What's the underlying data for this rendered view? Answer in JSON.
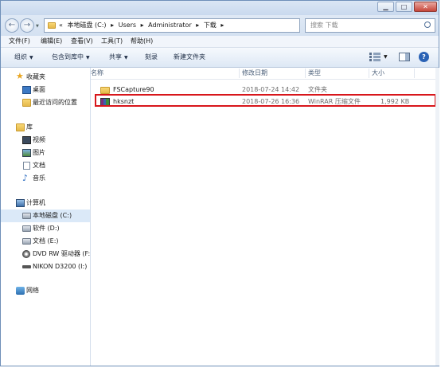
{
  "address": {
    "prefix": "«",
    "crumbs": [
      "本地磁盘 (C:)",
      "Users",
      "Administrator",
      "下载"
    ],
    "sep": "▸"
  },
  "search": {
    "placeholder": "搜索 下载"
  },
  "menu": [
    "文件(F)",
    "编辑(E)",
    "查看(V)",
    "工具(T)",
    "帮助(H)"
  ],
  "toolbar": {
    "organize": "组织",
    "include": "包含到库中",
    "share": "共享",
    "burn": "刻录",
    "new_folder": "新建文件夹",
    "dropdown": "▼"
  },
  "nav": {
    "favorites": "收藏夹",
    "desktop": "桌面",
    "recent": "最近访问的位置",
    "libraries": "库",
    "videos": "视频",
    "pictures": "图片",
    "documents": "文档",
    "music": "音乐",
    "computer": "计算机",
    "drive_c": "本地磁盘 (C:)",
    "drive_d": "软件 (D:)",
    "drive_e": "文档 (E:)",
    "drive_f": "DVD RW 驱动器 (F:",
    "drive_i": "NIKON D3200 (I:)",
    "network": "网络"
  },
  "columns": {
    "name": "名称",
    "modified": "修改日期",
    "type": "类型",
    "size": "大小"
  },
  "files": [
    {
      "name": "FSCapture90",
      "modified": "2018-07-24 14:42",
      "type": "文件夹",
      "size": ""
    },
    {
      "name": "hksnzt",
      "modified": "2018-07-26 16:36",
      "type": "WinRAR 压缩文件",
      "size": "1,992 KB"
    }
  ],
  "colors": {
    "highlight": "#d8161b",
    "selected_nav": "#dbe9f8"
  }
}
